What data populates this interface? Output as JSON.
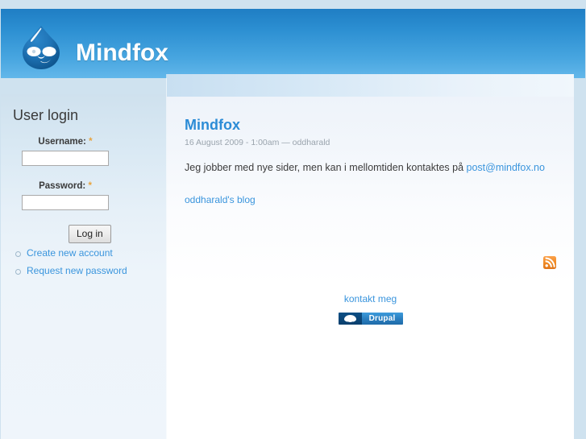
{
  "site": {
    "name": "Mindfox",
    "logo_icon": "drupal-droplet-icon"
  },
  "sidebar": {
    "block_title": "User login",
    "username": {
      "label": "Username:",
      "required_marker": "*",
      "value": "",
      "placeholder": ""
    },
    "password": {
      "label": "Password:",
      "required_marker": "*",
      "value": "",
      "placeholder": ""
    },
    "submit_label": "Log in",
    "links": [
      {
        "label": "Create new account",
        "icon": "bullet-circle-icon"
      },
      {
        "label": "Request new password",
        "icon": "bullet-circle-icon"
      }
    ]
  },
  "content": {
    "node": {
      "title": "Mindfox",
      "submitted": "16 August 2009 - 1:00am — oddharald",
      "body_prefix": "Jeg jobber med nye sider, men kan i mellomtiden kontaktes på ",
      "body_link": "post@mindfox.no",
      "links": [
        {
          "label": "oddharald's blog"
        }
      ]
    },
    "feed_icon": "rss-feed-icon"
  },
  "footer": {
    "link_label": "kontakt meg",
    "powered_by": {
      "label": "Drupal",
      "icon": "drupal-droplet-icon"
    }
  },
  "colors": {
    "header_blue_top": "#1f7ec4",
    "header_blue_bottom": "#63b7ea",
    "link_blue": "#3a95dd",
    "title_blue": "#2c8cd6",
    "required_orange": "#e8a33d",
    "rss_orange": "#f08a24",
    "sidebar_bg": "#e6f0f8",
    "page_bg": "#cfe2ef"
  }
}
